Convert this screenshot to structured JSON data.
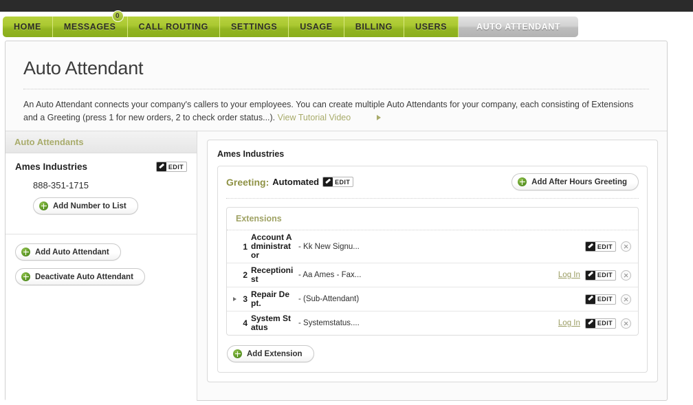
{
  "nav": {
    "items": [
      {
        "label": "HOME",
        "active": false,
        "badge": null
      },
      {
        "label": "MESSAGES",
        "active": false,
        "badge": "0"
      },
      {
        "label": "CALL ROUTING",
        "active": false,
        "badge": null
      },
      {
        "label": "SETTINGS",
        "active": false,
        "badge": null
      },
      {
        "label": "USAGE",
        "active": false,
        "badge": null
      },
      {
        "label": "BILLING",
        "active": false,
        "badge": null
      },
      {
        "label": "USERS",
        "active": false,
        "badge": null
      },
      {
        "label": "AUTO ATTENDANT",
        "active": true,
        "badge": null
      }
    ]
  },
  "page": {
    "title": "Auto Attendant",
    "description": "An Auto Attendant connects your company's callers to your employees. You can create multiple Auto Attendants for your company, each consisting of Extensions and a Greeting (press 1 for new orders, 2 to check order status...).",
    "tutorial_link": "View Tutorial Video"
  },
  "sidebar": {
    "header": "Auto Attendants",
    "attendant_name": "Ames Industries",
    "edit_label": "EDIT",
    "phone": "888-351-1715",
    "add_number_label": "Add Number to List",
    "add_attendant_label": "Add Auto Attendant",
    "deactivate_label": "Deactivate Auto Attendant"
  },
  "main": {
    "card_title": "Ames Industries",
    "greeting_label": "Greeting:",
    "greeting_value": "Automated",
    "greeting_edit_label": "EDIT",
    "add_after_hours_label": "Add After Hours Greeting",
    "extensions_header": "Extensions",
    "add_extension_label": "Add Extension",
    "edit_label": "EDIT",
    "login_label": "Log In",
    "extensions": [
      {
        "num": "1",
        "name": "Account Administrator",
        "desc": "- Kk New Signu...",
        "login": false,
        "expandable": false
      },
      {
        "num": "2",
        "name": "Receptionist",
        "desc": "- Aa Ames - Fax...",
        "login": true,
        "expandable": false
      },
      {
        "num": "3",
        "name": "Repair Dept.",
        "desc": "- (Sub-Attendant)",
        "login": false,
        "expandable": true
      },
      {
        "num": "4",
        "name": "System Status",
        "desc": "- Systemstatus....",
        "login": true,
        "expandable": false
      }
    ]
  },
  "colors": {
    "nav_green": "#a7c52f",
    "accent_olive": "#9fa264",
    "link_olive": "#a8ab6a",
    "active_tab_gray": "#c6c6c6"
  }
}
